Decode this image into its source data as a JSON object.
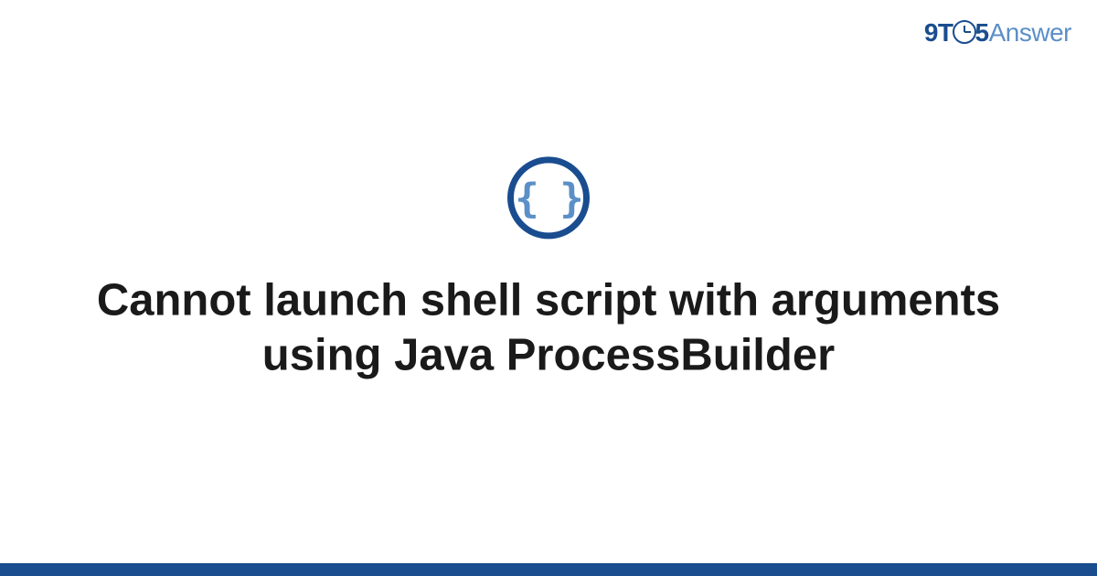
{
  "logo": {
    "prefix": "9T",
    "suffix": "5",
    "brand": "Answer"
  },
  "icon": {
    "name": "code-braces-icon",
    "glyph": "{ }"
  },
  "title": "Cannot launch shell script with arguments using Java ProcessBuilder",
  "colors": {
    "primary": "#1a4d8f",
    "accent": "#5b8fc7"
  }
}
